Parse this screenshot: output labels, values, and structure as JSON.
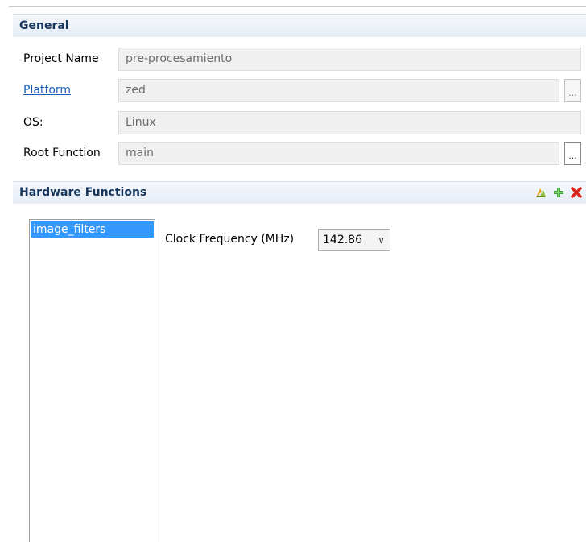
{
  "general": {
    "title": "General",
    "project_name_label": "Project Name",
    "project_name_value": "pre-procesamiento",
    "platform_label": "Platform",
    "platform_value": "zed",
    "platform_browse": "...",
    "os_label": "OS:",
    "os_value": "Linux",
    "root_function_label": "Root Function",
    "root_function_value": "main",
    "root_function_browse": "..."
  },
  "hardware_functions": {
    "title": "Hardware Functions",
    "toolbar_icons": [
      "estimate-performance-icon",
      "add-icon",
      "remove-icon"
    ],
    "functions": [
      "image_filters"
    ],
    "clock_label": "Clock Frequency (MHz)",
    "clock_value": "142.86"
  },
  "colors": {
    "header_text": "#17365d",
    "link": "#1a5fb4",
    "selection": "#3399ff"
  }
}
